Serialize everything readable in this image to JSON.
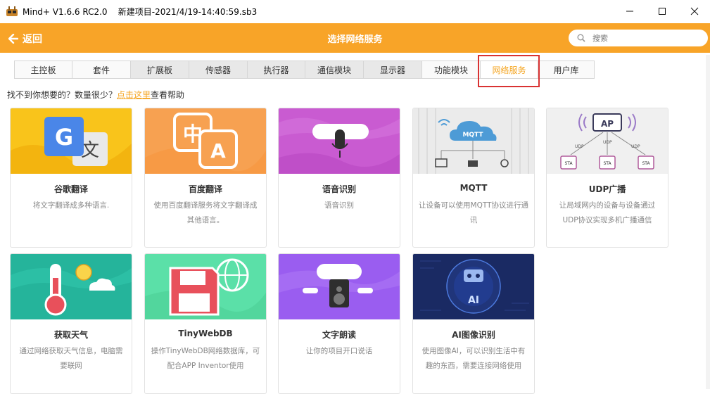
{
  "window": {
    "title": "Mind+ V1.6.6 RC2.0    新建项目-2021/4/19-14:40:59.sb3",
    "minimize_label": "—",
    "maximize_label": "☐",
    "close_label": "✕"
  },
  "header": {
    "back_label": "返回",
    "title": "选择网络服务",
    "search_placeholder": "搜索"
  },
  "tabs": [
    {
      "label": "主控板"
    },
    {
      "label": "套件"
    },
    {
      "label": "扩展板"
    },
    {
      "label": "传感器"
    },
    {
      "label": "执行器"
    },
    {
      "label": "通信模块"
    },
    {
      "label": "显示器"
    },
    {
      "label": "功能模块"
    },
    {
      "label": "网络服务"
    },
    {
      "label": "用户库"
    }
  ],
  "help": {
    "prefix": "找不到你想要的？数量很少？",
    "link": "点击这里",
    "suffix": "查看帮助"
  },
  "cards": [
    {
      "name": "谷歌翻译",
      "desc": "将文字翻译成多种语言.",
      "color": "#f9c41b"
    },
    {
      "name": "百度翻译",
      "desc": "使用百度翻译服务将文字翻译成其他语言。",
      "color": "#f7a151"
    },
    {
      "name": "语音识别",
      "desc": "语音识别",
      "color": "#c95bd1"
    },
    {
      "name": "MQTT",
      "desc": "让设备可以使用MQTT协议进行通讯",
      "color": "#e9e9e9",
      "badge": "MQTT"
    },
    {
      "name": "UDP广播",
      "desc": "让局域网内的设备与设备通过UDP协议实现多机广播通信",
      "color": "#f0f0f0",
      "badge": "AP",
      "sta_label": "STA",
      "udp_label": "UDP"
    },
    {
      "name": "获取天气",
      "desc": "通过网络获取天气信息，电脑需要联网",
      "color": "#25b49b"
    },
    {
      "name": "TinyWebDB",
      "desc": "操作TinyWebDB网络数据库，可配合APP Inventor使用",
      "color": "#5be0a8"
    },
    {
      "name": "文字朗读",
      "desc": "让你的项目开口说话",
      "color": "#9a5df0"
    },
    {
      "name": "AI图像识别",
      "desc": "使用图像AI，可以识别生活中有趣的东西，需要连接网络使用",
      "color": "#1a2a63",
      "badge": "AI"
    }
  ],
  "icons": {
    "back": "arrow-left-icon",
    "search": "magnifier-icon",
    "app": "mind-plus-logo-icon"
  }
}
